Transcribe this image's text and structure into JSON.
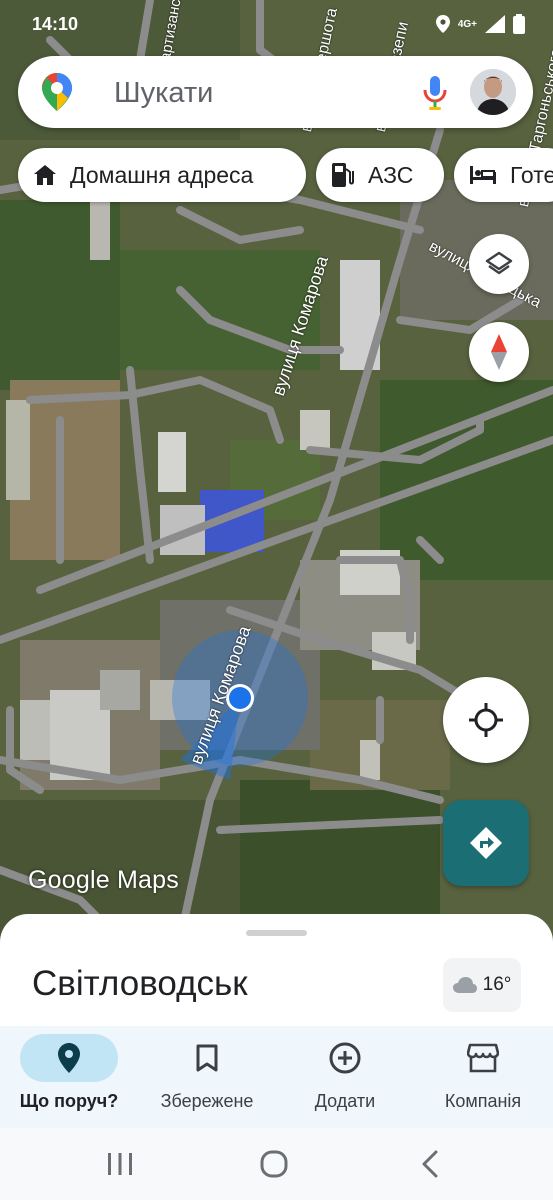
{
  "status_bar": {
    "time": "14:10",
    "network": "4G+"
  },
  "search": {
    "placeholder": "Шукати"
  },
  "chips": [
    {
      "label": "Домашня адреса",
      "icon": "home-icon"
    },
    {
      "label": "АЗС",
      "icon": "gas-station-icon"
    },
    {
      "label": "Готелі",
      "icon": "bed-icon"
    }
  ],
  "map": {
    "street_labels": [
      "вулиця Комарова",
      "вулиця Комарова",
      "вулиця Мазепи",
      "вулиця Шершота",
      "вулиця Таргоньського",
      "вулиця Козацька",
      "Партизанська"
    ],
    "logo": "Google Maps"
  },
  "sheet": {
    "title": "Світловодськ",
    "weather": "16°"
  },
  "nav": [
    {
      "label": "Що поруч?",
      "icon": "pin-icon",
      "active": true
    },
    {
      "label": "Збережене",
      "icon": "bookmark-icon",
      "active": false
    },
    {
      "label": "Додати",
      "icon": "add-circle-icon",
      "active": false
    },
    {
      "label": "Компанія",
      "icon": "store-icon",
      "active": false
    }
  ],
  "colors": {
    "accent": "#1a6e74",
    "location_dot": "#1a73e8",
    "nav_background": "#eff6fc",
    "active_pill": "#c2e5f6"
  }
}
